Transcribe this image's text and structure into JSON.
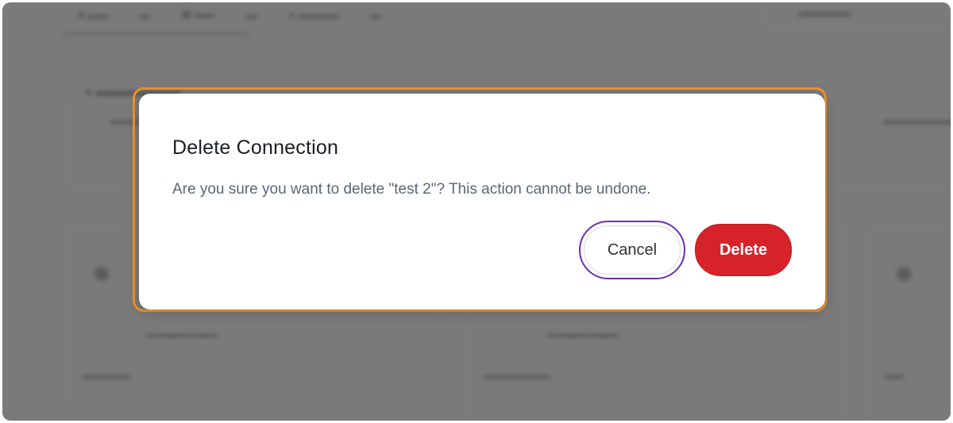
{
  "dialog": {
    "title": "Delete Connection",
    "message": "Are you sure you want to delete \"test 2\"? This action cannot be undone.",
    "cancel_label": "Cancel",
    "delete_label": "Delete"
  },
  "colors": {
    "highlight": "#f0922b",
    "delete_button": "#d6232a",
    "focus_ring": "#6b2fb3",
    "message_text": "#5a6579"
  }
}
